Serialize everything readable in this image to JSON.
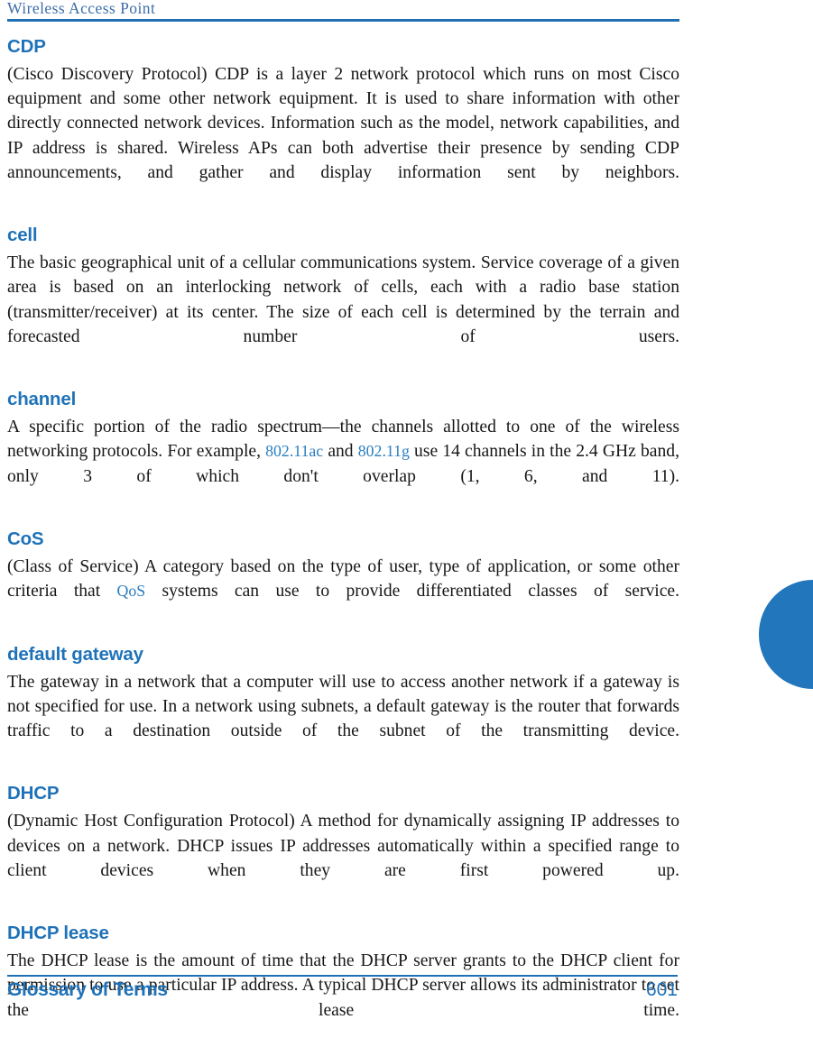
{
  "header": {
    "running_head": "Wireless Access Point"
  },
  "footer": {
    "section_title": "Glossary of Terms",
    "page_number": "601"
  },
  "colors": {
    "heading_blue": "#1f72b8",
    "running_head_blue": "#3c6da8",
    "rule_blue": "#1f6fb2",
    "xref_blue": "#2a7ec0",
    "thumb_tab_blue": "#2276bc",
    "body_text": "#161616"
  },
  "glossary": {
    "entries": [
      {
        "term": "CDP",
        "body_1": "(Cisco Discovery Protocol) CDP is a layer 2 network protocol which runs on most Cisco equipment and some other network equipment. It is used to share information with other directly connected network devices. Information such as the model, network capabilities, and IP address is shared. Wireless APs can both advertise their presence by sending CDP announcements, and gather and display information sent by neighbors."
      },
      {
        "term": "cell",
        "body_1": "The basic geographical unit of a cellular communications system. Service coverage of a given area is based on an interlocking network of cells, each with a radio base station (transmitter/receiver) at its center. The size of each cell is determined by the terrain and forecasted number of users."
      },
      {
        "term": "channel",
        "body_1": "A specific portion of the radio spectrum—the channels allotted to one of the wireless networking protocols. For example, ",
        "xref_1": "802.11ac",
        "body_2": " and ",
        "xref_2": "802.11g",
        "body_3": " use 14 channels in the 2.4 GHz band, only 3 of which don't overlap (1, 6, and 11)."
      },
      {
        "term": "CoS",
        "body_1": "(Class of Service) A category based on the type of user, type of application, or some other criteria that ",
        "xref_1": "QoS",
        "body_2": " systems can use to provide differentiated classes of service."
      },
      {
        "term": "default gateway",
        "body_1": "The gateway in a network that a computer will use to access another network if a gateway is not specified for use. In a network using subnets, a default gateway is the router that forwards traffic to a destination outside of the subnet of the transmitting device."
      },
      {
        "term": "DHCP",
        "body_1": "(Dynamic Host Configuration Protocol) A method for dynamically assigning IP addresses to devices on a network. DHCP issues IP addresses automatically within a specified range to client devices when they are first powered up."
      },
      {
        "term": "DHCP lease",
        "body_1": "The DHCP lease is the amount of time that the DHCP server grants to the DHCP client for permission to use a particular IP address. A typical DHCP server allows its administrator to set the lease time."
      }
    ]
  }
}
